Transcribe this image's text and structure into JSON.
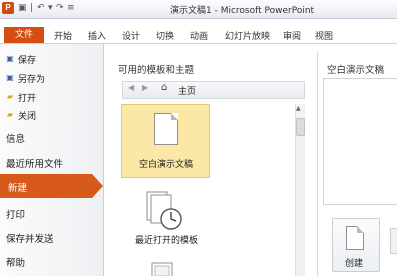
{
  "window": {
    "title": "演示文稿1 - Microsoft PowerPoint",
    "app_icon_letter": "P"
  },
  "quick_access": {
    "save_icon": "save-icon",
    "undo_icon": "undo-icon",
    "redo_icon": "redo-icon"
  },
  "ribbon": {
    "file_tab": "文件",
    "tabs": [
      "开始",
      "插入",
      "设计",
      "切换",
      "动画",
      "幻灯片放映",
      "审阅",
      "视图"
    ]
  },
  "nav": {
    "save": "保存",
    "save_as": "另存为",
    "open": "打开",
    "close": "关闭",
    "info": "信息",
    "recent": "最近所用文件",
    "new": "新建",
    "print": "打印",
    "save_send": "保存并发送",
    "help": "帮助"
  },
  "templates": {
    "heading": "可用的模板和主题",
    "path": "主页",
    "tiles": [
      {
        "label": "空白演示文稿"
      },
      {
        "label": "最近打开的模板"
      }
    ]
  },
  "preview": {
    "heading": "空白演示文稿",
    "create_label": "创建"
  },
  "colors": {
    "accent": "#d75a1a",
    "file_tab": "#d64d14",
    "selected_tile": "#fbe8a6"
  }
}
